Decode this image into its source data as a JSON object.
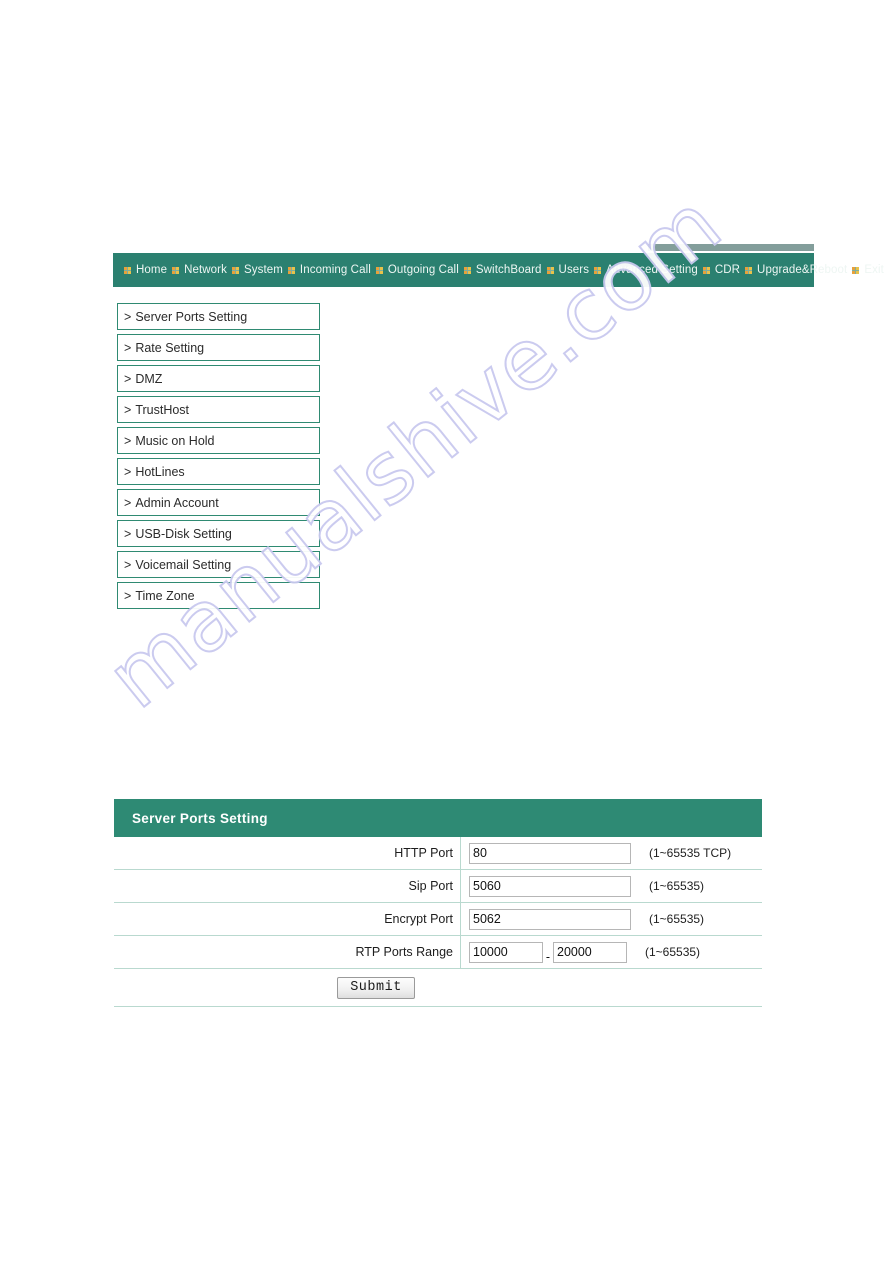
{
  "nav": {
    "items": [
      {
        "label": "Home"
      },
      {
        "label": "Network"
      },
      {
        "label": "System"
      },
      {
        "label": "Incoming Call"
      },
      {
        "label": "Outgoing Call"
      },
      {
        "label": "SwitchBoard"
      },
      {
        "label": "Users"
      },
      {
        "label": "Advanced Setting"
      },
      {
        "label": "CDR"
      },
      {
        "label": "Upgrade&Reboot"
      },
      {
        "label": "Exit"
      }
    ],
    "bullet_icon": "grid-bullet-icon",
    "background_color": "#2b8070",
    "text_color": "#eef6f3"
  },
  "sidebar": {
    "prefix": ">",
    "items": [
      {
        "label": "Server Ports Setting"
      },
      {
        "label": "Rate Setting"
      },
      {
        "label": "DMZ"
      },
      {
        "label": "TrustHost"
      },
      {
        "label": "Music on Hold"
      },
      {
        "label": "HotLines"
      },
      {
        "label": "Admin Account"
      },
      {
        "label": "USB-Disk Setting"
      },
      {
        "label": "Voicemail Setting"
      },
      {
        "label": "Time Zone"
      }
    ],
    "border_color": "#2f8a72"
  },
  "panel": {
    "title": "Server Ports Setting",
    "header_color": "#2e8a74",
    "rows": [
      {
        "label": "HTTP Port",
        "value": "80",
        "placeholder": "",
        "hint": "(1~65535  TCP)"
      },
      {
        "label": "Sip Port",
        "value": "5060",
        "placeholder": "",
        "hint": "(1~65535)"
      },
      {
        "label": "Encrypt Port",
        "value": "5062",
        "placeholder": "",
        "hint": "(1~65535)"
      },
      {
        "label": "RTP Ports Range",
        "value_start": "10000",
        "value_end": "20000",
        "separator": "-",
        "hint": "(1~65535)"
      }
    ],
    "submit_label": "Submit"
  },
  "watermark": {
    "text": "manualshive.com",
    "color": "#c9c9ef"
  }
}
